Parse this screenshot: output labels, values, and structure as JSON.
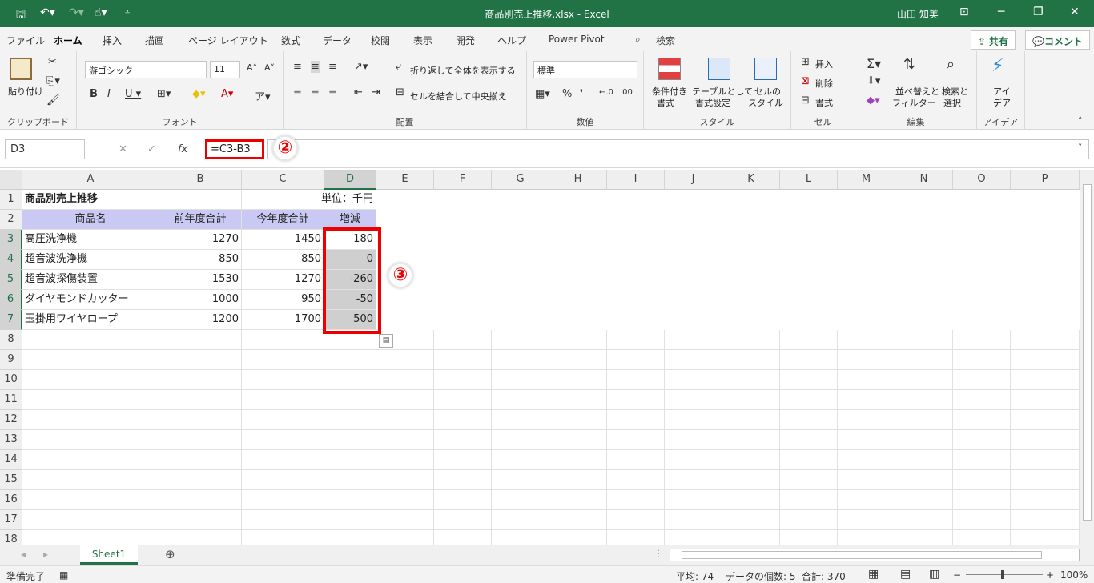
{
  "window": {
    "title": "商品別売上推移.xlsx - Excel",
    "user": "山田 知美",
    "colors": {
      "brand": "#217346",
      "highlight": "#e00000"
    }
  },
  "ribbon": {
    "tabs": [
      "ファイル",
      "ホーム",
      "挿入",
      "描画",
      "ページ レイアウト",
      "数式",
      "データ",
      "校閲",
      "表示",
      "開発",
      "ヘルプ",
      "Power Pivot",
      "検索"
    ],
    "active_tab": "ホーム",
    "share": "共有",
    "comment": "コメント",
    "clipboard": {
      "paste": "貼り付け",
      "label": "クリップボード"
    },
    "font": {
      "name": "游ゴシック",
      "size": "11",
      "label": "フォント"
    },
    "alignment": {
      "wrap": "折り返して全体を表示する",
      "merge": "セルを結合して中央揃え",
      "label": "配置"
    },
    "number": {
      "format": "標準",
      "label": "数値"
    },
    "styles": {
      "conditional": "条件付き",
      "conditional2": "書式",
      "table": "テーブルとして",
      "table2": "書式設定",
      "cell": "セルの",
      "cell2": "スタイル",
      "label": "スタイル"
    },
    "cells": {
      "insert": "挿入",
      "delete": "削除",
      "format": "書式",
      "label": "セル"
    },
    "editing": {
      "sort": "並べ替えと",
      "sort2": "フィルター",
      "find": "検索と",
      "find2": "選択",
      "label": "編集"
    },
    "ideas": {
      "btn": "アイ",
      "btn2": "デア",
      "label": "アイデア"
    }
  },
  "formula_bar": {
    "name_box": "D3",
    "formula": "=C3-B3",
    "fx": "fx"
  },
  "annotations": {
    "marker2": "②",
    "marker3": "③"
  },
  "columns": [
    "A",
    "B",
    "C",
    "D",
    "E",
    "F",
    "G",
    "H",
    "I",
    "J",
    "K",
    "L",
    "M",
    "N",
    "O",
    "P"
  ],
  "rows": [
    "1",
    "2",
    "3",
    "4",
    "5",
    "6",
    "7",
    "8",
    "9",
    "10",
    "11",
    "12",
    "13",
    "14",
    "15",
    "16",
    "17",
    "18"
  ],
  "sheet": {
    "a1": "商品別売上推移",
    "c1": "単位：千円",
    "headers": [
      "商品名",
      "前年度合計",
      "今年度合計",
      "増減"
    ],
    "data": [
      [
        "高圧洗浄機",
        "1270",
        "1450",
        "180"
      ],
      [
        "超音波洗浄機",
        "850",
        "850",
        "0"
      ],
      [
        "超音波探傷装置",
        "1530",
        "1270",
        "-260"
      ],
      [
        "ダイヤモンドカッター",
        "1000",
        "950",
        "-50"
      ],
      [
        "玉掛用ワイヤロープ",
        "1200",
        "1700",
        "500"
      ]
    ]
  },
  "sheet_tab": "Sheet1",
  "status": {
    "ready": "準備完了",
    "average": "平均: 74",
    "count": "データの個数: 5",
    "sum": "合計: 370",
    "zoom": "100%"
  }
}
